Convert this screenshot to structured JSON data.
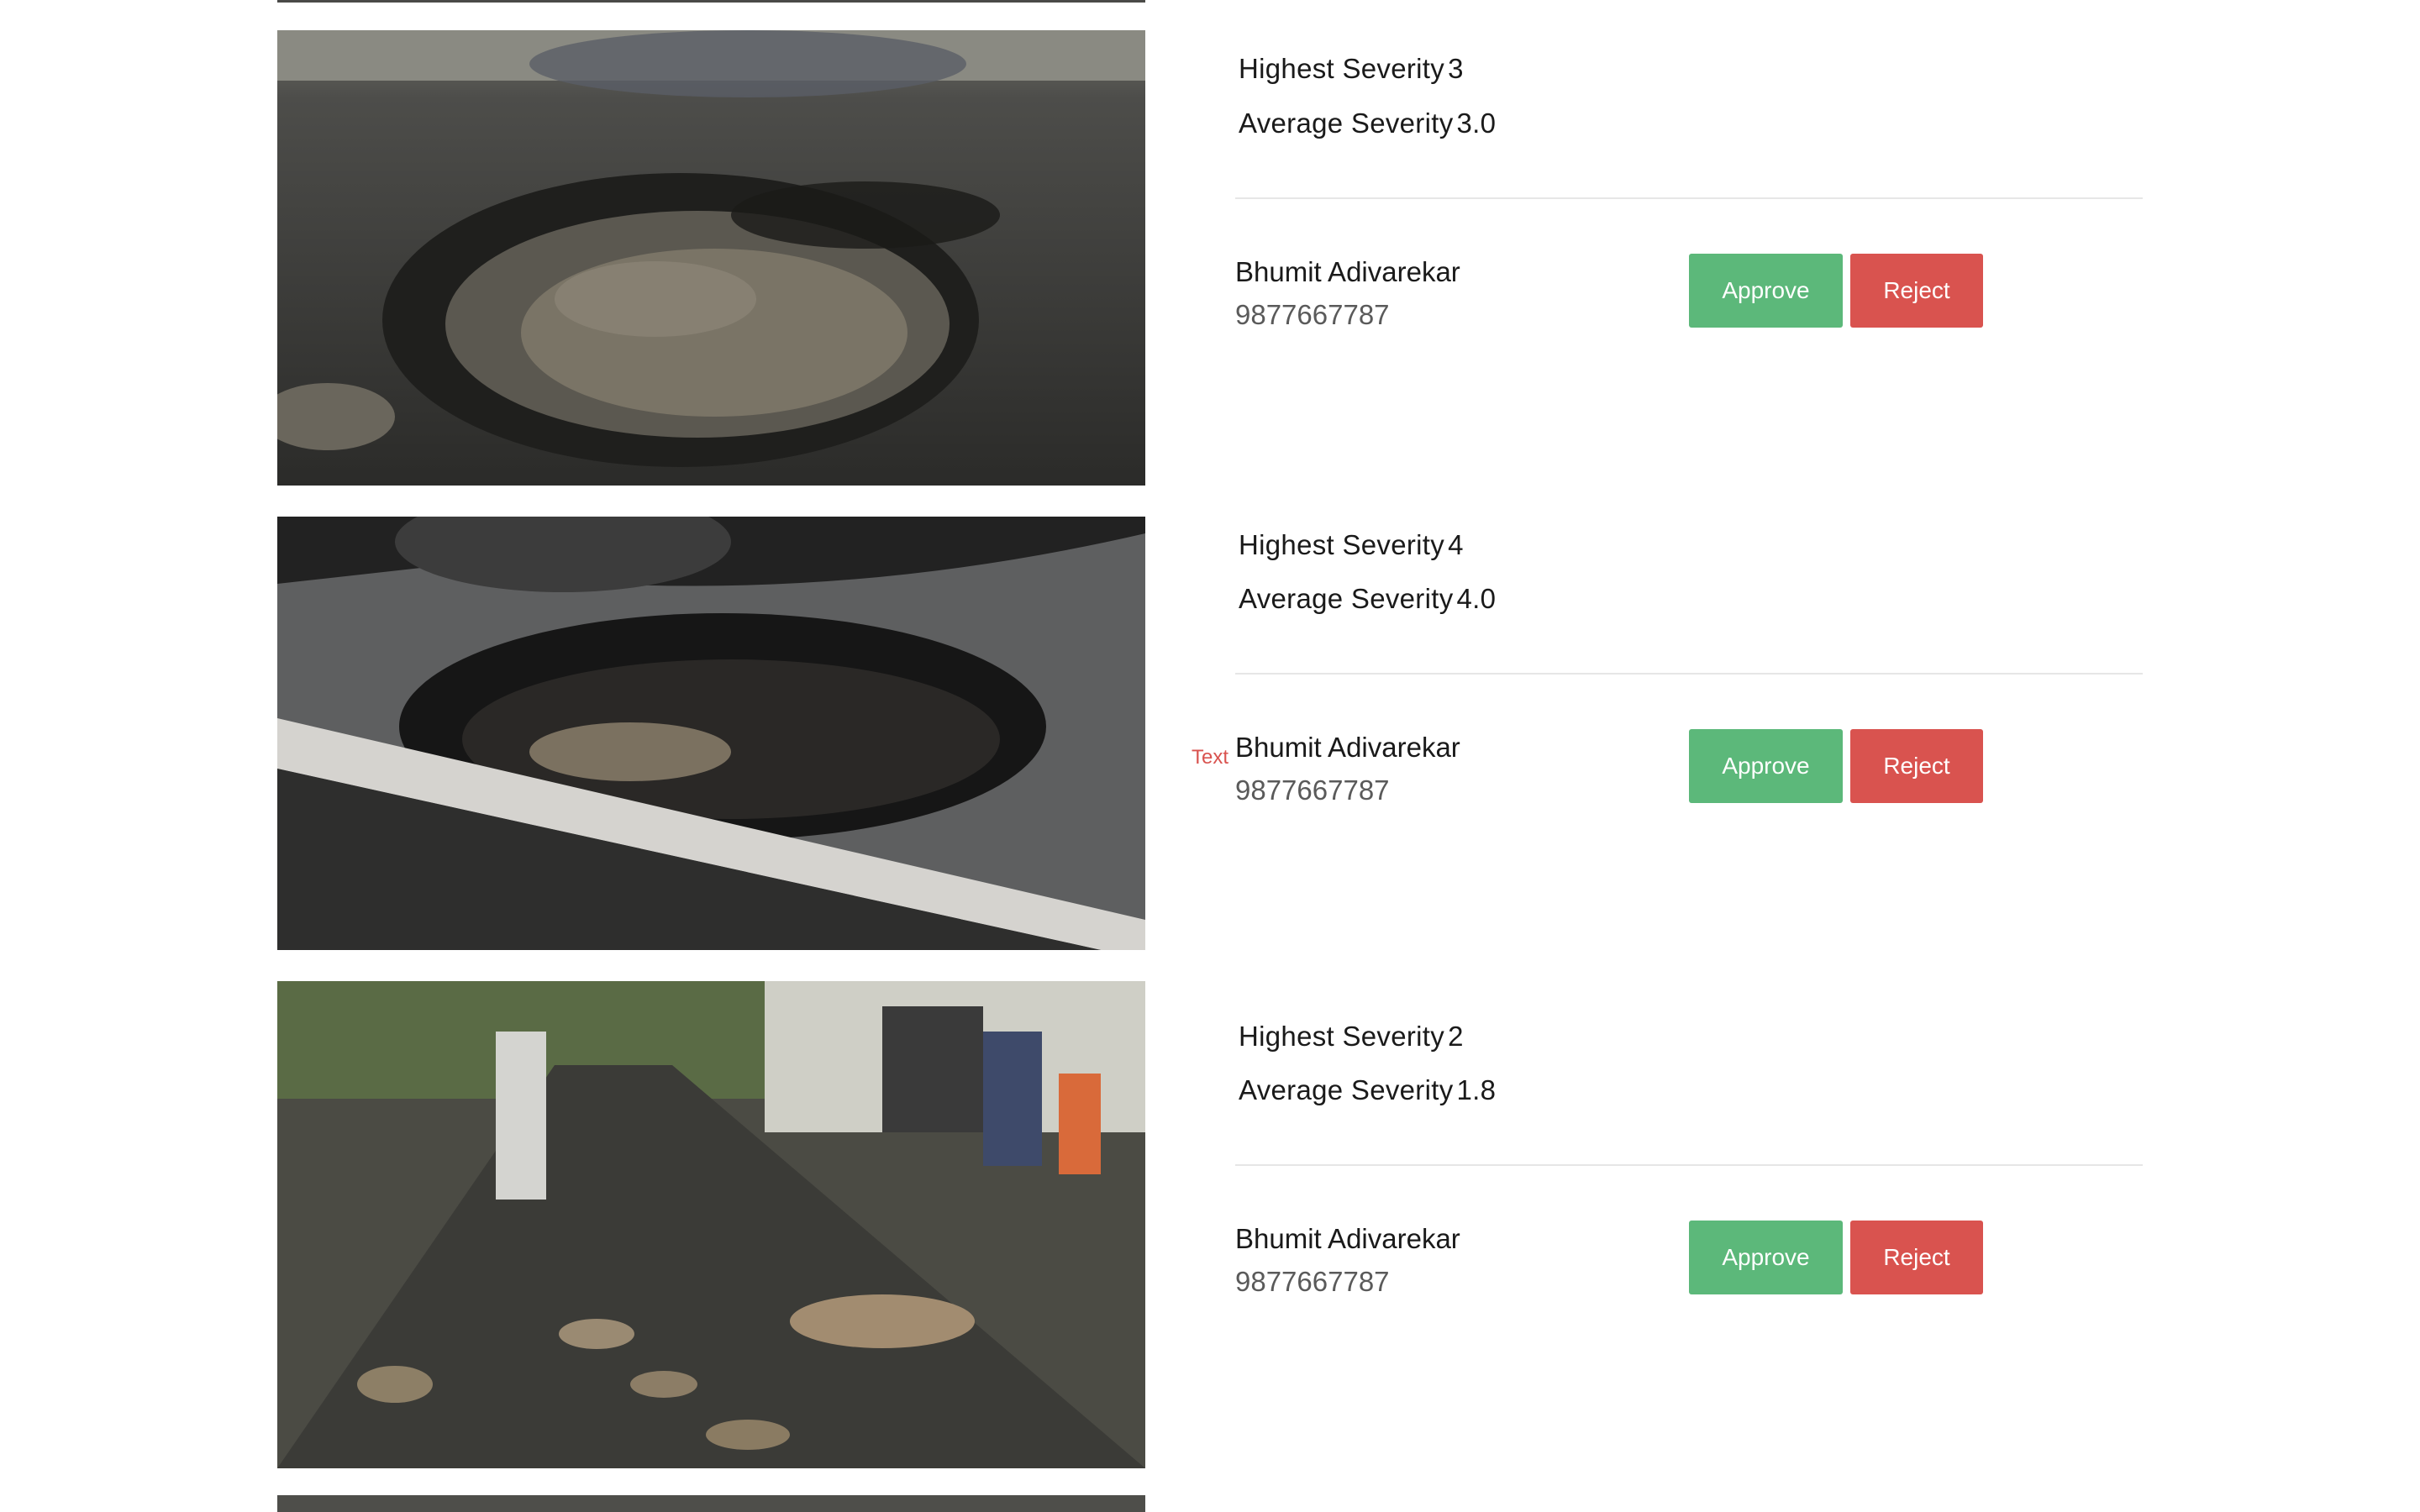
{
  "reports": [
    {
      "highest_severity_label": "Highest Severity",
      "highest_severity_value": "3",
      "average_severity_label": "Average Severity",
      "average_severity_value": "3.0",
      "reporter_name": "Bhumit Adivarekar",
      "reporter_phone": "9877667787",
      "approve_label": "Approve",
      "reject_label": "Reject"
    },
    {
      "highest_severity_label": "Highest Severity",
      "highest_severity_value": "4",
      "average_severity_label": "Average Severity",
      "average_severity_value": "4.0",
      "reporter_name": "Bhumit Adivarekar",
      "reporter_phone": "9877667787",
      "approve_label": "Approve",
      "reject_label": "Reject",
      "stray_text": "Text"
    },
    {
      "highest_severity_label": "Highest Severity",
      "highest_severity_value": "2",
      "average_severity_label": "Average Severity",
      "average_severity_value": "1.8",
      "reporter_name": "Bhumit Adivarekar",
      "reporter_phone": "9877667787",
      "approve_label": "Approve",
      "reject_label": "Reject"
    }
  ],
  "colors": {
    "approve": "#5cb87a",
    "reject": "#d9534f",
    "divider": "#e6e6e6"
  }
}
